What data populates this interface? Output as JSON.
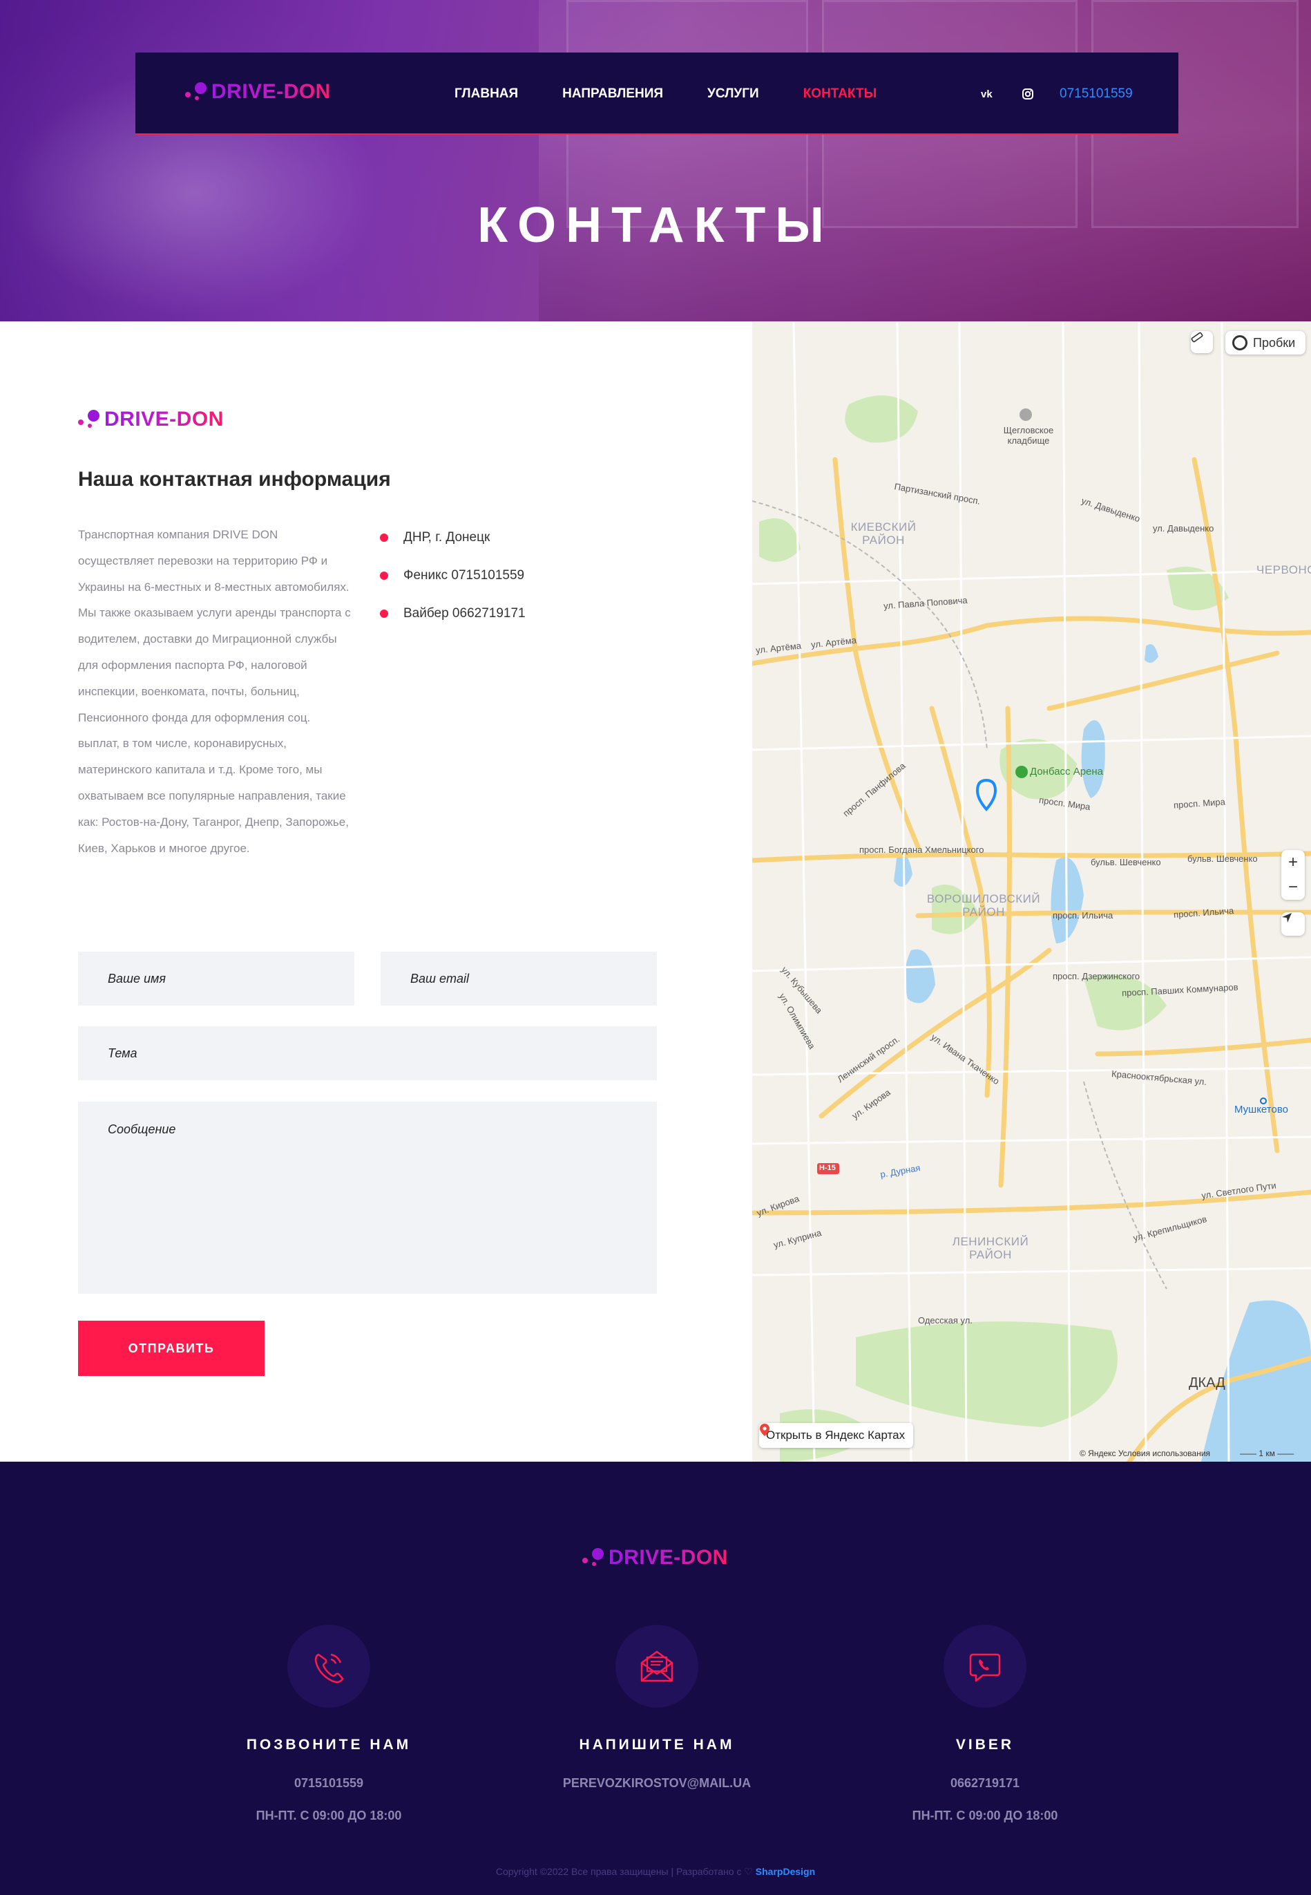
{
  "brand": {
    "logo_text": "DRIVE-DON"
  },
  "nav": {
    "items": [
      {
        "label": "ГЛАВНАЯ",
        "active": false
      },
      {
        "label": "НАПРАВЛЕНИЯ",
        "active": false
      },
      {
        "label": "УСЛУГИ",
        "active": false
      },
      {
        "label": "КОНТАКТЫ",
        "active": true
      }
    ],
    "social": [
      {
        "icon": "vk-icon",
        "glyph": "vk"
      },
      {
        "icon": "instagram-icon",
        "glyph": ""
      }
    ],
    "phone": "0715101559"
  },
  "hero": {
    "title": "КОНТАКТЫ"
  },
  "contact": {
    "title": "Наша контактная информация",
    "description": "Транспортная компания DRIVE DON осуществляет перевозки на территорию РФ и Украины на 6-местных и 8-местных автомобилях. Мы также оказываем услуги аренды транспорта с водителем, доставки до Миграционной службы для оформления паспорта РФ, налоговой инспекции, военкомата, почты, больниц, Пенсионного фонда для оформления соц. выплат, в том числе, коронавирусных, материнского капитала и т.д. Кроме того, мы охватываем все популярные направления, такие как: Ростов-на-Дону, Таганрог, Днепр, Запорожье, Киев, Харьков и многое другое.",
    "details": [
      "ДНР, г. Донецк",
      "Феникс 0715101559",
      "Вайбер 0662719171"
    ],
    "accent_color": "#ff1a4b"
  },
  "form": {
    "name_placeholder": "Ваше имя",
    "email_placeholder": "Ваш email",
    "subject_placeholder": "Тема",
    "message_placeholder": "Сообщение",
    "submit_label": "ОТПРАВИТЬ"
  },
  "map": {
    "traffic_label": "Пробки",
    "open_label": "Открыть в Яндекс Картах",
    "copyright": "© Яндекс   Условия использования",
    "scale": "1 км",
    "zoom_in": "+",
    "zoom_out": "−",
    "labels": {
      "cemetery": "Щегловское кладбище",
      "kievsky": "КИЕВСКИЙ РАЙОН",
      "voroshilovsky": "ВОРОШИЛОВСКИЙ РАЙОН",
      "leninsky": "ЛЕНИНСКИЙ РАЙОН",
      "chervonogvardeisky": "ЧЕРВОНО",
      "donbass_arena": "Донбасс Арена",
      "mushketovo": "Мушкетово",
      "dkad": "ДКАД",
      "partizansky": "Партизанский просп.",
      "davydenko1": "ул. Давыденко",
      "davydenko2": "ул. Давыденко",
      "pavla_popovicha": "ул. Павла Поповича",
      "artema1": "ул. Артёма",
      "artema2": "ул. Артёма",
      "mira1": "просп. Мира",
      "mira2": "просп. Мира",
      "shevchenko1": "бульв. Шевченко",
      "shevchenko2": "бульв. Шевченко",
      "ilyicha1": "просп. Ильича",
      "ilyicha2": "просп. Ильича",
      "bogdana": "просп. Богдана Хмельницкого",
      "dzerzhinskogo": "просп. Дзержинского",
      "pavshih": "просп. Павших Коммунаров",
      "krasnooktyabrskaya": "Краснооктябрьская ул.",
      "ivana_tkachenko": "ул. Ивана Ткаченко",
      "leninsky_prosp": "Ленинский просп.",
      "kirova1": "ул. Кирова",
      "kirova2": "ул. Кирова",
      "odesskaya": "Одесская ул.",
      "svetlogo_puti": "ул. Светлого Пути",
      "krepilschikov": "ул. Крепильщиков",
      "kuprina": "ул. Куприна",
      "kalinina": "ул. Кубышева",
      "olimpieva": "ул. Олимпиева",
      "r_dubnaya": "р. Дурная",
      "h15": "Н-15",
      "marshrut": "просп. Панфилова"
    }
  },
  "footer": {
    "logo_text": "DRIVE-DON",
    "features": [
      {
        "icon": "phone-icon",
        "title": "ПОЗВОНИТЕ НАМ",
        "line1": "0715101559",
        "line2": "ПН-ПТ. С 09:00 ДО 18:00"
      },
      {
        "icon": "mail-icon",
        "title": "НАПИШИТЕ НАМ",
        "line1": "PEREVOZKIROSTOV@MAIL.UA",
        "line2": ""
      },
      {
        "icon": "viber-icon",
        "title": "VIBER",
        "line1": "0662719171",
        "line2": "ПН-ПТ. С 09:00 ДО 18:00"
      }
    ],
    "copyright": "Copyright ©2022 Все права защищены | Разработано с ♡",
    "developer": "SharpDesign"
  }
}
